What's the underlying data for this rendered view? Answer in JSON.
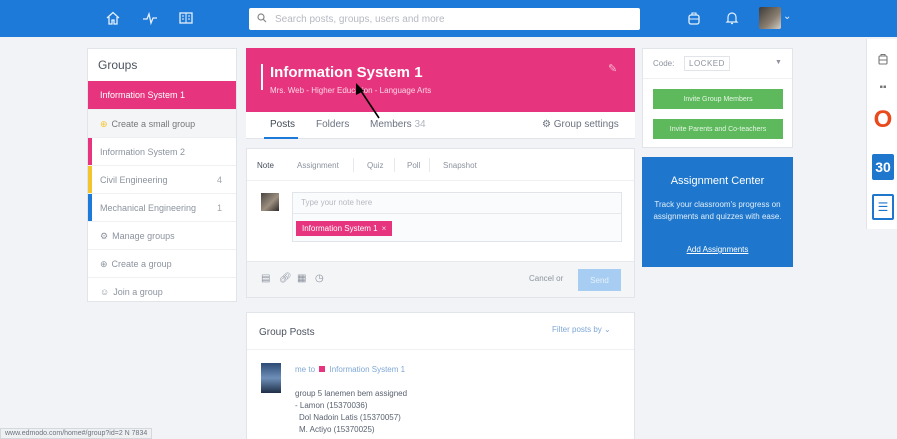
{
  "topbar": {
    "nav_icons": [
      "home-icon",
      "progress-icon",
      "library-icon"
    ],
    "search_placeholder": "Search posts, groups, users and more",
    "right_icons": [
      "backpack-icon",
      "bell-icon"
    ],
    "colors": {
      "bar": "#1d7ad8"
    }
  },
  "sidebar": {
    "title": "Groups",
    "items": [
      {
        "label": "Information System 1",
        "active": true
      },
      {
        "label": "Create a small group",
        "icon": "plus-circle-icon"
      },
      {
        "label": "Information System 2",
        "color": "#e6357e"
      },
      {
        "label": "Civil Engineering",
        "color": "#f2c530",
        "count": "4"
      },
      {
        "label": "Mechanical Engineering",
        "color": "#1d7ad8",
        "count": "1"
      },
      {
        "label": "Manage groups",
        "icon": "gear-icon"
      },
      {
        "label": "Create a group",
        "icon": "plus-circle-icon"
      },
      {
        "label": "Join a group",
        "icon": "users-icon"
      }
    ]
  },
  "group": {
    "title": "Information System 1",
    "subtitle": "Mrs. Web - Higher Education - Language Arts",
    "tabs": [
      "Posts",
      "Folders",
      "Members"
    ],
    "members_count": "34",
    "settings_label": "Group settings",
    "colors": {
      "accent": "#e6357e"
    }
  },
  "composer": {
    "post_tabs": [
      "Note",
      "Assignment",
      "Quiz",
      "Poll",
      "Snapshot"
    ],
    "placeholder": "Type your note here",
    "recipient": "Information System 1",
    "recipient_remove": "×",
    "cancel_label": "Cancel",
    "or_label": "or",
    "send_label": "Send"
  },
  "posts": {
    "title": "Group Posts",
    "filter_label": "Filter posts by",
    "first_post": {
      "meta_from": "me",
      "meta_to": "to",
      "meta_group": "Information System 1",
      "line1": "group 5 lanemen bem assigned",
      "line2": "- Lamon (15370036)",
      "line3": "Dol Nadoin Latis (15370057)",
      "line4": "M. Actiyo (15370025)"
    }
  },
  "code_card": {
    "label": "Code:",
    "value": "LOCKED",
    "invite_members": "Invite Group Members",
    "invite_parents": "Invite Parents and Co-teachers",
    "colors": {
      "button": "#5db95c"
    }
  },
  "assignment_center": {
    "title": "Assignment Center",
    "body": "Track your classroom's progress on assignments and quizzes with ease.",
    "link": "Add Assignments",
    "colors": {
      "bg": "#1e77cc"
    }
  },
  "right_apps": {
    "calendar_day": "30",
    "icons": [
      "backpack-icon",
      "apps-grid-icon",
      "office-icon",
      "calendar-icon",
      "sway-icon"
    ]
  },
  "status_bar": {
    "url": "www.edmodo.com/home#/group?id=2 N 7834"
  }
}
